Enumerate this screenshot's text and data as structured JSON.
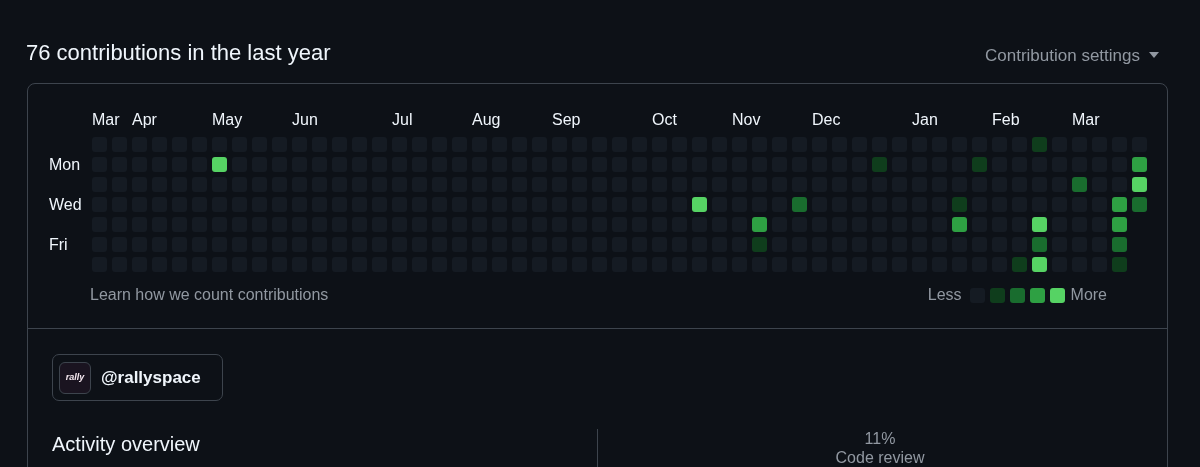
{
  "heading": "76 contributions in the last year",
  "settings_menu": "Contribution settings",
  "weekday_labels": [
    "Mon",
    "Wed",
    "Fri"
  ],
  "weeks": [
    {
      "month": "Mar",
      "days": [
        {
          "color": "#151b23"
        },
        {
          "color": "#151b23"
        },
        {
          "color": "#151b23"
        },
        {
          "color": "#151b23"
        },
        {
          "color": "#151b23"
        },
        {
          "color": "#151b23"
        },
        {
          "color": "#151b23"
        }
      ]
    },
    {
      "days": [
        {
          "color": "#151b23"
        },
        {
          "color": "#151b23"
        },
        {
          "color": "#151b23"
        },
        {
          "color": "#151b23"
        },
        {
          "color": "#151b23"
        },
        {
          "color": "#151b23"
        },
        {
          "color": "#151b23"
        }
      ]
    },
    {
      "month": "Apr",
      "days": [
        {
          "color": "#151b23"
        },
        {
          "color": "#151b23"
        },
        {
          "color": "#151b23"
        },
        {
          "color": "#151b23"
        },
        {
          "color": "#151b23"
        },
        {
          "color": "#151b23"
        },
        {
          "color": "#151b23"
        }
      ]
    },
    {
      "days": [
        {
          "color": "#151b23"
        },
        {
          "color": "#151b23"
        },
        {
          "color": "#151b23"
        },
        {
          "color": "#151b23"
        },
        {
          "color": "#151b23"
        },
        {
          "color": "#151b23"
        },
        {
          "color": "#151b23"
        }
      ]
    },
    {
      "days": [
        {
          "color": "#151b23"
        },
        {
          "color": "#151b23"
        },
        {
          "color": "#151b23"
        },
        {
          "color": "#151b23"
        },
        {
          "color": "#151b23"
        },
        {
          "color": "#151b23"
        },
        {
          "color": "#151b23"
        }
      ]
    },
    {
      "days": [
        {
          "color": "#151b23"
        },
        {
          "color": "#151b23"
        },
        {
          "color": "#151b23"
        },
        {
          "color": "#151b23"
        },
        {
          "color": "#151b23"
        },
        {
          "color": "#151b23"
        },
        {
          "color": "#151b23"
        }
      ]
    },
    {
      "month": "May",
      "days": [
        {
          "color": "#151b23"
        },
        {
          "color": "#56d364"
        },
        {
          "color": "#151b23"
        },
        {
          "color": "#151b23"
        },
        {
          "color": "#151b23"
        },
        {
          "color": "#151b23"
        },
        {
          "color": "#151b23"
        }
      ]
    },
    {
      "days": [
        {
          "color": "#151b23"
        },
        {
          "color": "#151b23"
        },
        {
          "color": "#151b23"
        },
        {
          "color": "#151b23"
        },
        {
          "color": "#151b23"
        },
        {
          "color": "#151b23"
        },
        {
          "color": "#151b23"
        }
      ]
    },
    {
      "days": [
        {
          "color": "#151b23"
        },
        {
          "color": "#151b23"
        },
        {
          "color": "#151b23"
        },
        {
          "color": "#151b23"
        },
        {
          "color": "#151b23"
        },
        {
          "color": "#151b23"
        },
        {
          "color": "#151b23"
        }
      ]
    },
    {
      "days": [
        {
          "color": "#151b23"
        },
        {
          "color": "#151b23"
        },
        {
          "color": "#151b23"
        },
        {
          "color": "#151b23"
        },
        {
          "color": "#151b23"
        },
        {
          "color": "#151b23"
        },
        {
          "color": "#151b23"
        }
      ]
    },
    {
      "month": "Jun",
      "days": [
        {
          "color": "#151b23"
        },
        {
          "color": "#151b23"
        },
        {
          "color": "#151b23"
        },
        {
          "color": "#151b23"
        },
        {
          "color": "#151b23"
        },
        {
          "color": "#151b23"
        },
        {
          "color": "#151b23"
        }
      ]
    },
    {
      "days": [
        {
          "color": "#151b23"
        },
        {
          "color": "#151b23"
        },
        {
          "color": "#151b23"
        },
        {
          "color": "#151b23"
        },
        {
          "color": "#151b23"
        },
        {
          "color": "#151b23"
        },
        {
          "color": "#151b23"
        }
      ]
    },
    {
      "days": [
        {
          "color": "#151b23"
        },
        {
          "color": "#151b23"
        },
        {
          "color": "#151b23"
        },
        {
          "color": "#151b23"
        },
        {
          "color": "#151b23"
        },
        {
          "color": "#151b23"
        },
        {
          "color": "#151b23"
        }
      ]
    },
    {
      "days": [
        {
          "color": "#151b23"
        },
        {
          "color": "#151b23"
        },
        {
          "color": "#151b23"
        },
        {
          "color": "#151b23"
        },
        {
          "color": "#151b23"
        },
        {
          "color": "#151b23"
        },
        {
          "color": "#151b23"
        }
      ]
    },
    {
      "days": [
        {
          "color": "#151b23"
        },
        {
          "color": "#151b23"
        },
        {
          "color": "#151b23"
        },
        {
          "color": "#151b23"
        },
        {
          "color": "#151b23"
        },
        {
          "color": "#151b23"
        },
        {
          "color": "#151b23"
        }
      ]
    },
    {
      "month": "Jul",
      "days": [
        {
          "color": "#151b23"
        },
        {
          "color": "#151b23"
        },
        {
          "color": "#151b23"
        },
        {
          "color": "#151b23"
        },
        {
          "color": "#151b23"
        },
        {
          "color": "#151b23"
        },
        {
          "color": "#151b23"
        }
      ]
    },
    {
      "days": [
        {
          "color": "#151b23"
        },
        {
          "color": "#151b23"
        },
        {
          "color": "#151b23"
        },
        {
          "color": "#151b23"
        },
        {
          "color": "#151b23"
        },
        {
          "color": "#151b23"
        },
        {
          "color": "#151b23"
        }
      ]
    },
    {
      "days": [
        {
          "color": "#151b23"
        },
        {
          "color": "#151b23"
        },
        {
          "color": "#151b23"
        },
        {
          "color": "#151b23"
        },
        {
          "color": "#151b23"
        },
        {
          "color": "#151b23"
        },
        {
          "color": "#151b23"
        }
      ]
    },
    {
      "days": [
        {
          "color": "#151b23"
        },
        {
          "color": "#151b23"
        },
        {
          "color": "#151b23"
        },
        {
          "color": "#151b23"
        },
        {
          "color": "#151b23"
        },
        {
          "color": "#151b23"
        },
        {
          "color": "#151b23"
        }
      ]
    },
    {
      "month": "Aug",
      "days": [
        {
          "color": "#151b23"
        },
        {
          "color": "#151b23"
        },
        {
          "color": "#151b23"
        },
        {
          "color": "#151b23"
        },
        {
          "color": "#151b23"
        },
        {
          "color": "#151b23"
        },
        {
          "color": "#151b23"
        }
      ]
    },
    {
      "days": [
        {
          "color": "#151b23"
        },
        {
          "color": "#151b23"
        },
        {
          "color": "#151b23"
        },
        {
          "color": "#151b23"
        },
        {
          "color": "#151b23"
        },
        {
          "color": "#151b23"
        },
        {
          "color": "#151b23"
        }
      ]
    },
    {
      "days": [
        {
          "color": "#151b23"
        },
        {
          "color": "#151b23"
        },
        {
          "color": "#151b23"
        },
        {
          "color": "#151b23"
        },
        {
          "color": "#151b23"
        },
        {
          "color": "#151b23"
        },
        {
          "color": "#151b23"
        }
      ]
    },
    {
      "days": [
        {
          "color": "#151b23"
        },
        {
          "color": "#151b23"
        },
        {
          "color": "#151b23"
        },
        {
          "color": "#151b23"
        },
        {
          "color": "#151b23"
        },
        {
          "color": "#151b23"
        },
        {
          "color": "#151b23"
        }
      ]
    },
    {
      "month": "Sep",
      "days": [
        {
          "color": "#151b23"
        },
        {
          "color": "#151b23"
        },
        {
          "color": "#151b23"
        },
        {
          "color": "#151b23"
        },
        {
          "color": "#151b23"
        },
        {
          "color": "#151b23"
        },
        {
          "color": "#151b23"
        }
      ]
    },
    {
      "days": [
        {
          "color": "#151b23"
        },
        {
          "color": "#151b23"
        },
        {
          "color": "#151b23"
        },
        {
          "color": "#151b23"
        },
        {
          "color": "#151b23"
        },
        {
          "color": "#151b23"
        },
        {
          "color": "#151b23"
        }
      ]
    },
    {
      "days": [
        {
          "color": "#151b23"
        },
        {
          "color": "#151b23"
        },
        {
          "color": "#151b23"
        },
        {
          "color": "#151b23"
        },
        {
          "color": "#151b23"
        },
        {
          "color": "#151b23"
        },
        {
          "color": "#151b23"
        }
      ]
    },
    {
      "days": [
        {
          "color": "#151b23"
        },
        {
          "color": "#151b23"
        },
        {
          "color": "#151b23"
        },
        {
          "color": "#151b23"
        },
        {
          "color": "#151b23"
        },
        {
          "color": "#151b23"
        },
        {
          "color": "#151b23"
        }
      ]
    },
    {
      "days": [
        {
          "color": "#151b23"
        },
        {
          "color": "#151b23"
        },
        {
          "color": "#151b23"
        },
        {
          "color": "#151b23"
        },
        {
          "color": "#151b23"
        },
        {
          "color": "#151b23"
        },
        {
          "color": "#151b23"
        }
      ]
    },
    {
      "month": "Oct",
      "days": [
        {
          "color": "#151b23"
        },
        {
          "color": "#151b23"
        },
        {
          "color": "#151b23"
        },
        {
          "color": "#151b23"
        },
        {
          "color": "#151b23"
        },
        {
          "color": "#151b23"
        },
        {
          "color": "#151b23"
        }
      ]
    },
    {
      "days": [
        {
          "color": "#151b23"
        },
        {
          "color": "#151b23"
        },
        {
          "color": "#151b23"
        },
        {
          "color": "#151b23"
        },
        {
          "color": "#151b23"
        },
        {
          "color": "#151b23"
        },
        {
          "color": "#151b23"
        }
      ]
    },
    {
      "days": [
        {
          "color": "#151b23"
        },
        {
          "color": "#151b23"
        },
        {
          "color": "#151b23"
        },
        {
          "color": "#56d364"
        },
        {
          "color": "#151b23"
        },
        {
          "color": "#151b23"
        },
        {
          "color": "#151b23"
        }
      ]
    },
    {
      "days": [
        {
          "color": "#151b23"
        },
        {
          "color": "#151b23"
        },
        {
          "color": "#151b23"
        },
        {
          "color": "#151b23"
        },
        {
          "color": "#151b23"
        },
        {
          "color": "#151b23"
        },
        {
          "color": "#151b23"
        }
      ]
    },
    {
      "month": "Nov",
      "days": [
        {
          "color": "#151b23"
        },
        {
          "color": "#151b23"
        },
        {
          "color": "#151b23"
        },
        {
          "color": "#151b23"
        },
        {
          "color": "#151b23"
        },
        {
          "color": "#151b23"
        },
        {
          "color": "#151b23"
        }
      ]
    },
    {
      "days": [
        {
          "color": "#151b23"
        },
        {
          "color": "#151b23"
        },
        {
          "color": "#151b23"
        },
        {
          "color": "#151b23"
        },
        {
          "color": "#2ea043"
        },
        {
          "color": "#0f3d1c"
        },
        {
          "color": "#151b23"
        }
      ]
    },
    {
      "days": [
        {
          "color": "#151b23"
        },
        {
          "color": "#151b23"
        },
        {
          "color": "#151b23"
        },
        {
          "color": "#151b23"
        },
        {
          "color": "#151b23"
        },
        {
          "color": "#151b23"
        },
        {
          "color": "#151b23"
        }
      ]
    },
    {
      "days": [
        {
          "color": "#151b23"
        },
        {
          "color": "#151b23"
        },
        {
          "color": "#151b23"
        },
        {
          "color": "#196c2e"
        },
        {
          "color": "#151b23"
        },
        {
          "color": "#151b23"
        },
        {
          "color": "#151b23"
        }
      ]
    },
    {
      "month": "Dec",
      "days": [
        {
          "color": "#151b23"
        },
        {
          "color": "#151b23"
        },
        {
          "color": "#151b23"
        },
        {
          "color": "#151b23"
        },
        {
          "color": "#151b23"
        },
        {
          "color": "#151b23"
        },
        {
          "color": "#151b23"
        }
      ]
    },
    {
      "days": [
        {
          "color": "#151b23"
        },
        {
          "color": "#151b23"
        },
        {
          "color": "#151b23"
        },
        {
          "color": "#151b23"
        },
        {
          "color": "#151b23"
        },
        {
          "color": "#151b23"
        },
        {
          "color": "#151b23"
        }
      ]
    },
    {
      "days": [
        {
          "color": "#151b23"
        },
        {
          "color": "#151b23"
        },
        {
          "color": "#151b23"
        },
        {
          "color": "#151b23"
        },
        {
          "color": "#151b23"
        },
        {
          "color": "#151b23"
        },
        {
          "color": "#151b23"
        }
      ]
    },
    {
      "days": [
        {
          "color": "#151b23"
        },
        {
          "color": "#0f3d1c"
        },
        {
          "color": "#151b23"
        },
        {
          "color": "#151b23"
        },
        {
          "color": "#151b23"
        },
        {
          "color": "#151b23"
        },
        {
          "color": "#151b23"
        }
      ]
    },
    {
      "days": [
        {
          "color": "#151b23"
        },
        {
          "color": "#151b23"
        },
        {
          "color": "#151b23"
        },
        {
          "color": "#151b23"
        },
        {
          "color": "#151b23"
        },
        {
          "color": "#151b23"
        },
        {
          "color": "#151b23"
        }
      ]
    },
    {
      "month": "Jan",
      "days": [
        {
          "color": "#151b23"
        },
        {
          "color": "#151b23"
        },
        {
          "color": "#151b23"
        },
        {
          "color": "#151b23"
        },
        {
          "color": "#151b23"
        },
        {
          "color": "#151b23"
        },
        {
          "color": "#151b23"
        }
      ]
    },
    {
      "days": [
        {
          "color": "#151b23"
        },
        {
          "color": "#151b23"
        },
        {
          "color": "#151b23"
        },
        {
          "color": "#151b23"
        },
        {
          "color": "#151b23"
        },
        {
          "color": "#151b23"
        },
        {
          "color": "#151b23"
        }
      ]
    },
    {
      "days": [
        {
          "color": "#151b23"
        },
        {
          "color": "#151b23"
        },
        {
          "color": "#151b23"
        },
        {
          "color": "#0f3d1c"
        },
        {
          "color": "#2ea043"
        },
        {
          "color": "#151b23"
        },
        {
          "color": "#151b23"
        }
      ]
    },
    {
      "days": [
        {
          "color": "#151b23"
        },
        {
          "color": "#0f3d1c"
        },
        {
          "color": "#151b23"
        },
        {
          "color": "#151b23"
        },
        {
          "color": "#151b23"
        },
        {
          "color": "#151b23"
        },
        {
          "color": "#151b23"
        }
      ]
    },
    {
      "month": "Feb",
      "days": [
        {
          "color": "#151b23"
        },
        {
          "color": "#151b23"
        },
        {
          "color": "#151b23"
        },
        {
          "color": "#151b23"
        },
        {
          "color": "#151b23"
        },
        {
          "color": "#151b23"
        },
        {
          "color": "#151b23"
        }
      ]
    },
    {
      "days": [
        {
          "color": "#151b23"
        },
        {
          "color": "#151b23"
        },
        {
          "color": "#151b23"
        },
        {
          "color": "#151b23"
        },
        {
          "color": "#151b23"
        },
        {
          "color": "#151b23"
        },
        {
          "color": "#0f3d1c"
        }
      ]
    },
    {
      "days": [
        {
          "color": "#0f3d1c"
        },
        {
          "color": "#151b23"
        },
        {
          "color": "#151b23"
        },
        {
          "color": "#151b23"
        },
        {
          "color": "#56d364"
        },
        {
          "color": "#196c2e"
        },
        {
          "color": "#56d364"
        }
      ]
    },
    {
      "days": [
        {
          "color": "#151b23"
        },
        {
          "color": "#151b23"
        },
        {
          "color": "#151b23"
        },
        {
          "color": "#151b23"
        },
        {
          "color": "#151b23"
        },
        {
          "color": "#151b23"
        },
        {
          "color": "#151b23"
        }
      ]
    },
    {
      "month": "Mar",
      "days": [
        {
          "color": "#151b23"
        },
        {
          "color": "#151b23"
        },
        {
          "color": "#196c2e"
        },
        {
          "color": "#151b23"
        },
        {
          "color": "#151b23"
        },
        {
          "color": "#151b23"
        },
        {
          "color": "#151b23"
        }
      ]
    },
    {
      "days": [
        {
          "color": "#151b23"
        },
        {
          "color": "#151b23"
        },
        {
          "color": "#151b23"
        },
        {
          "color": "#151b23"
        },
        {
          "color": "#151b23"
        },
        {
          "color": "#151b23"
        },
        {
          "color": "#151b23"
        }
      ]
    },
    {
      "days": [
        {
          "color": "#151b23"
        },
        {
          "color": "#151b23"
        },
        {
          "color": "#151b23"
        },
        {
          "color": "#2ea043"
        },
        {
          "color": "#2ea043"
        },
        {
          "color": "#196c2e"
        },
        {
          "color": "#0f3d1c"
        }
      ]
    },
    {
      "days": [
        {
          "color": "#151b23"
        },
        {
          "color": "#2ea043"
        },
        {
          "color": "#56d364"
        },
        {
          "color": "#196c2e"
        }
      ]
    }
  ],
  "learn_link": "Learn how we count contributions",
  "legend": {
    "less": "Less",
    "more": "More",
    "swatches": [
      {
        "color": "#151b23"
      },
      {
        "color": "#0f3d1c"
      },
      {
        "color": "#196c2e"
      },
      {
        "color": "#2ea043"
      },
      {
        "color": "#56d364"
      }
    ]
  },
  "org_chip": {
    "logo_text": "rally",
    "name": "@rallyspace"
  },
  "activity_overview": {
    "title": "Activity overview",
    "share": "11%",
    "share_label": "Code review"
  }
}
